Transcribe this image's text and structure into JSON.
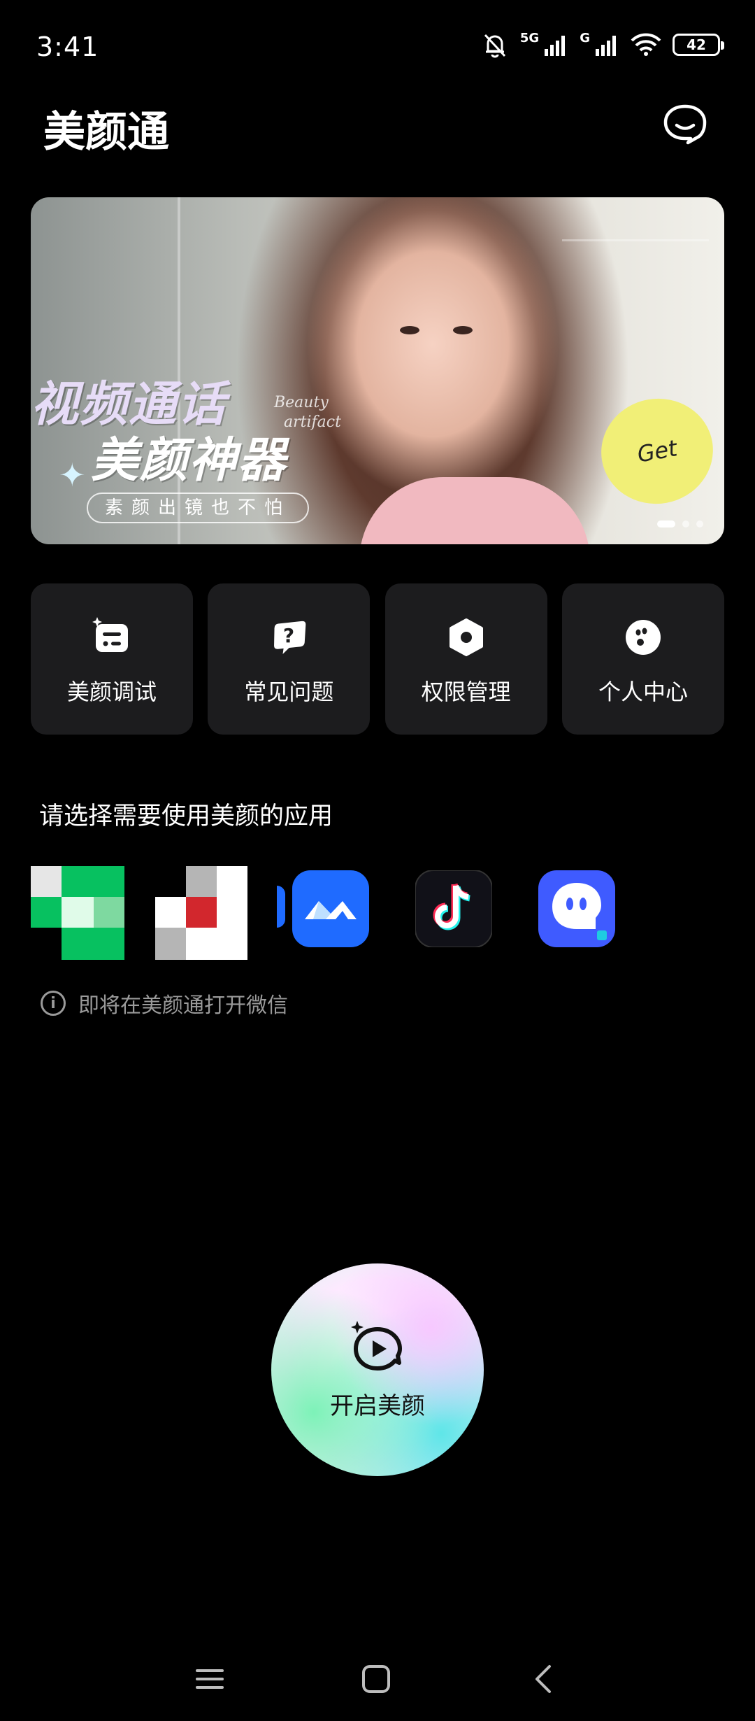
{
  "status_bar": {
    "time": "3:41",
    "network1": "5G",
    "network2": "G",
    "battery": "42"
  },
  "header": {
    "title": "美颜通",
    "chat_icon": "chat-bubble-smile-icon"
  },
  "banner": {
    "title_line1": "视频通话",
    "title_line2": "美颜神器",
    "subtitle": "素颜出镜也不怕",
    "deco_line1": "Beauty",
    "deco_line2": "artifact",
    "get_label": "Get",
    "page_count": 3,
    "active_page": 1
  },
  "quick_actions": [
    {
      "label": "美颜调试",
      "icon": "beauty-adjust-icon"
    },
    {
      "label": "常见问题",
      "icon": "faq-question-icon"
    },
    {
      "label": "权限管理",
      "icon": "permission-hexagon-icon"
    },
    {
      "label": "个人中心",
      "icon": "profile-smiley-icon"
    }
  ],
  "apps_section": {
    "title": "请选择需要使用美颜的应用",
    "apps": [
      {
        "icon": "wechat-app-icon"
      },
      {
        "icon": "qq-app-icon"
      },
      {
        "icon": "tencent-meeting-app-icon"
      },
      {
        "icon": "tiktok-app-icon"
      },
      {
        "icon": "chat-bot-app-icon"
      }
    ],
    "hint": "即将在美颜通打开微信"
  },
  "start_button": {
    "label": "开启美颜",
    "icon": "video-sparkle-icon"
  },
  "nav": {
    "menu_icon": "menu-icon",
    "home_icon": "home-square-icon",
    "back_icon": "back-chevron-icon"
  },
  "colors": {
    "background": "#000000",
    "card": "#1c1c1e",
    "hint_text": "#9a9a9a",
    "get_badge": "#f1ef77",
    "tiktok_bg": "#111118",
    "meeting_blue": "#1f6bff",
    "bot_blue": "#3f5bff"
  }
}
